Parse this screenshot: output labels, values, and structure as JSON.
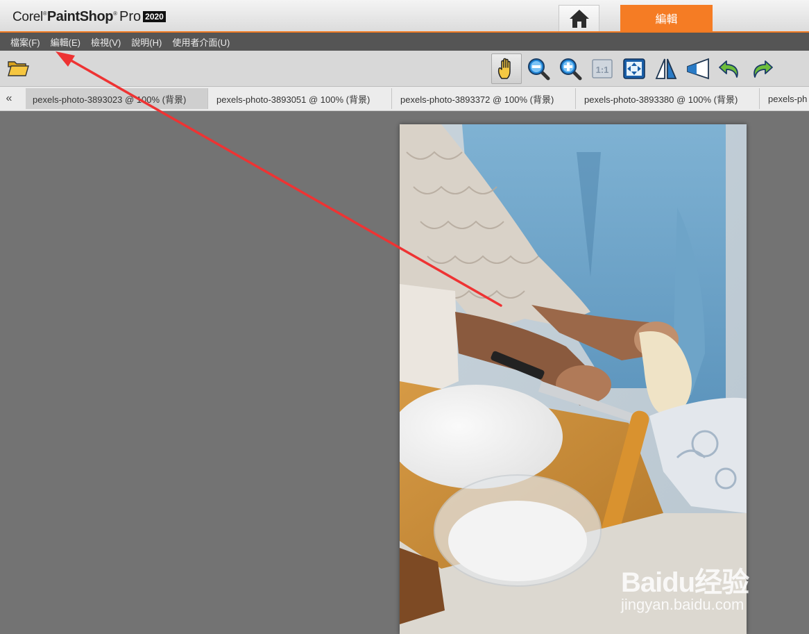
{
  "app": {
    "logo": {
      "corel": "Corel",
      "paintshop": "PaintShop",
      "pro": "Pro",
      "year": "2020"
    },
    "home_icon": "home-icon",
    "edit_tab_label": "編輯"
  },
  "menu": {
    "items": [
      {
        "label": "檔案(F)"
      },
      {
        "label": "編輯(E)"
      },
      {
        "label": "檢視(V)"
      },
      {
        "label": "說明(H)"
      },
      {
        "label": "使用者介面(U)"
      }
    ]
  },
  "toolbar": {
    "open_icon": "folder-open-icon",
    "tools": [
      {
        "icon": "pan-hand-icon",
        "active": true
      },
      {
        "icon": "zoom-out-icon"
      },
      {
        "icon": "zoom-in-icon"
      },
      {
        "icon": "actual-size-icon",
        "label": "1:1"
      },
      {
        "icon": "fit-to-window-icon"
      },
      {
        "icon": "flip-icon"
      },
      {
        "icon": "perspective-icon"
      },
      {
        "icon": "undo-icon"
      },
      {
        "icon": "redo-icon"
      }
    ]
  },
  "tabs": {
    "scroll_left": "«",
    "items": [
      {
        "label": "pexels-photo-3893023 @ 100% (背景)",
        "active": true
      },
      {
        "label": "pexels-photo-3893051 @ 100% (背景)"
      },
      {
        "label": "pexels-photo-3893372 @ 100% (背景)"
      },
      {
        "label": "pexels-photo-3893380 @ 100% (背景)"
      },
      {
        "label": "pexels-ph"
      }
    ]
  },
  "watermark": {
    "brand": "Baidu经验",
    "url": "jingyan.baidu.com"
  },
  "colors": {
    "accent": "#f57c24",
    "menubar": "#555555",
    "workspace": "#737373",
    "annotation": "#ee3333"
  }
}
